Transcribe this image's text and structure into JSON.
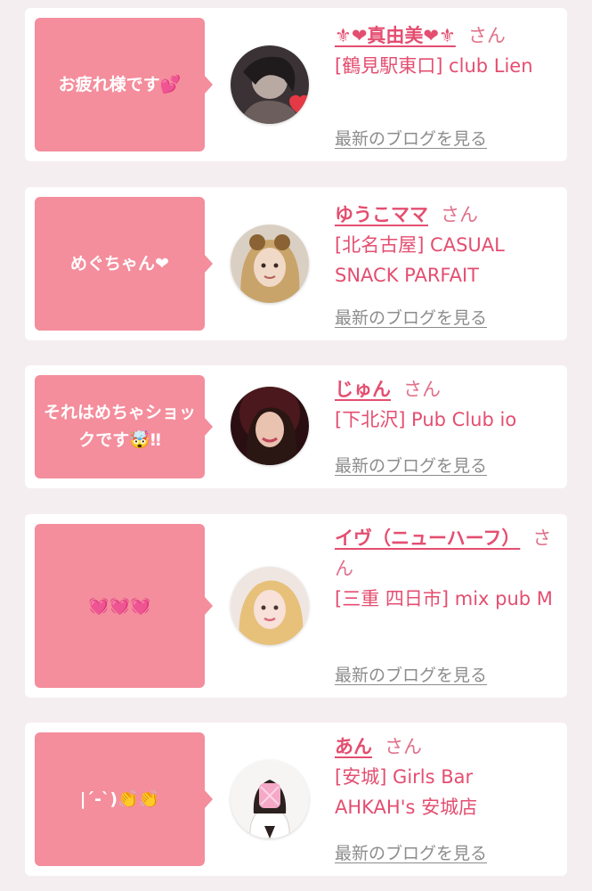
{
  "blog_link_label": "最新のブログを見る",
  "honorific": "さん",
  "colors": {
    "bubble": "#f48d9c",
    "accent": "#e44e70",
    "link_gray": "#8c8c8c",
    "background": "#f5eef0"
  },
  "entries": [
    {
      "message": "お疲れ様です💕",
      "name": "⚜❤真由美❤⚜",
      "shop": "[鶴見駅東口] club Lien",
      "avatar_icon": "profile-photo"
    },
    {
      "message": "めぐちゃん❤",
      "name": "ゆうこママ",
      "shop": "[北名古屋] CASUAL SNACK PARFAIT",
      "avatar_icon": "profile-photo"
    },
    {
      "message": "それはめちゃショックです🤯‼",
      "name": "じゅん",
      "shop": "[下北沢] Pub Club io",
      "avatar_icon": "profile-photo"
    },
    {
      "message": "💓💓💓",
      "name": "イヴ（ニューハーフ）",
      "shop": "[三重 四日市] mix pub M",
      "avatar_icon": "profile-photo"
    },
    {
      "message": "|´-`)👏👏",
      "name": "あん",
      "shop": "[安城] Girls Bar AHKAH's 安城店",
      "avatar_icon": "profile-photo"
    }
  ]
}
